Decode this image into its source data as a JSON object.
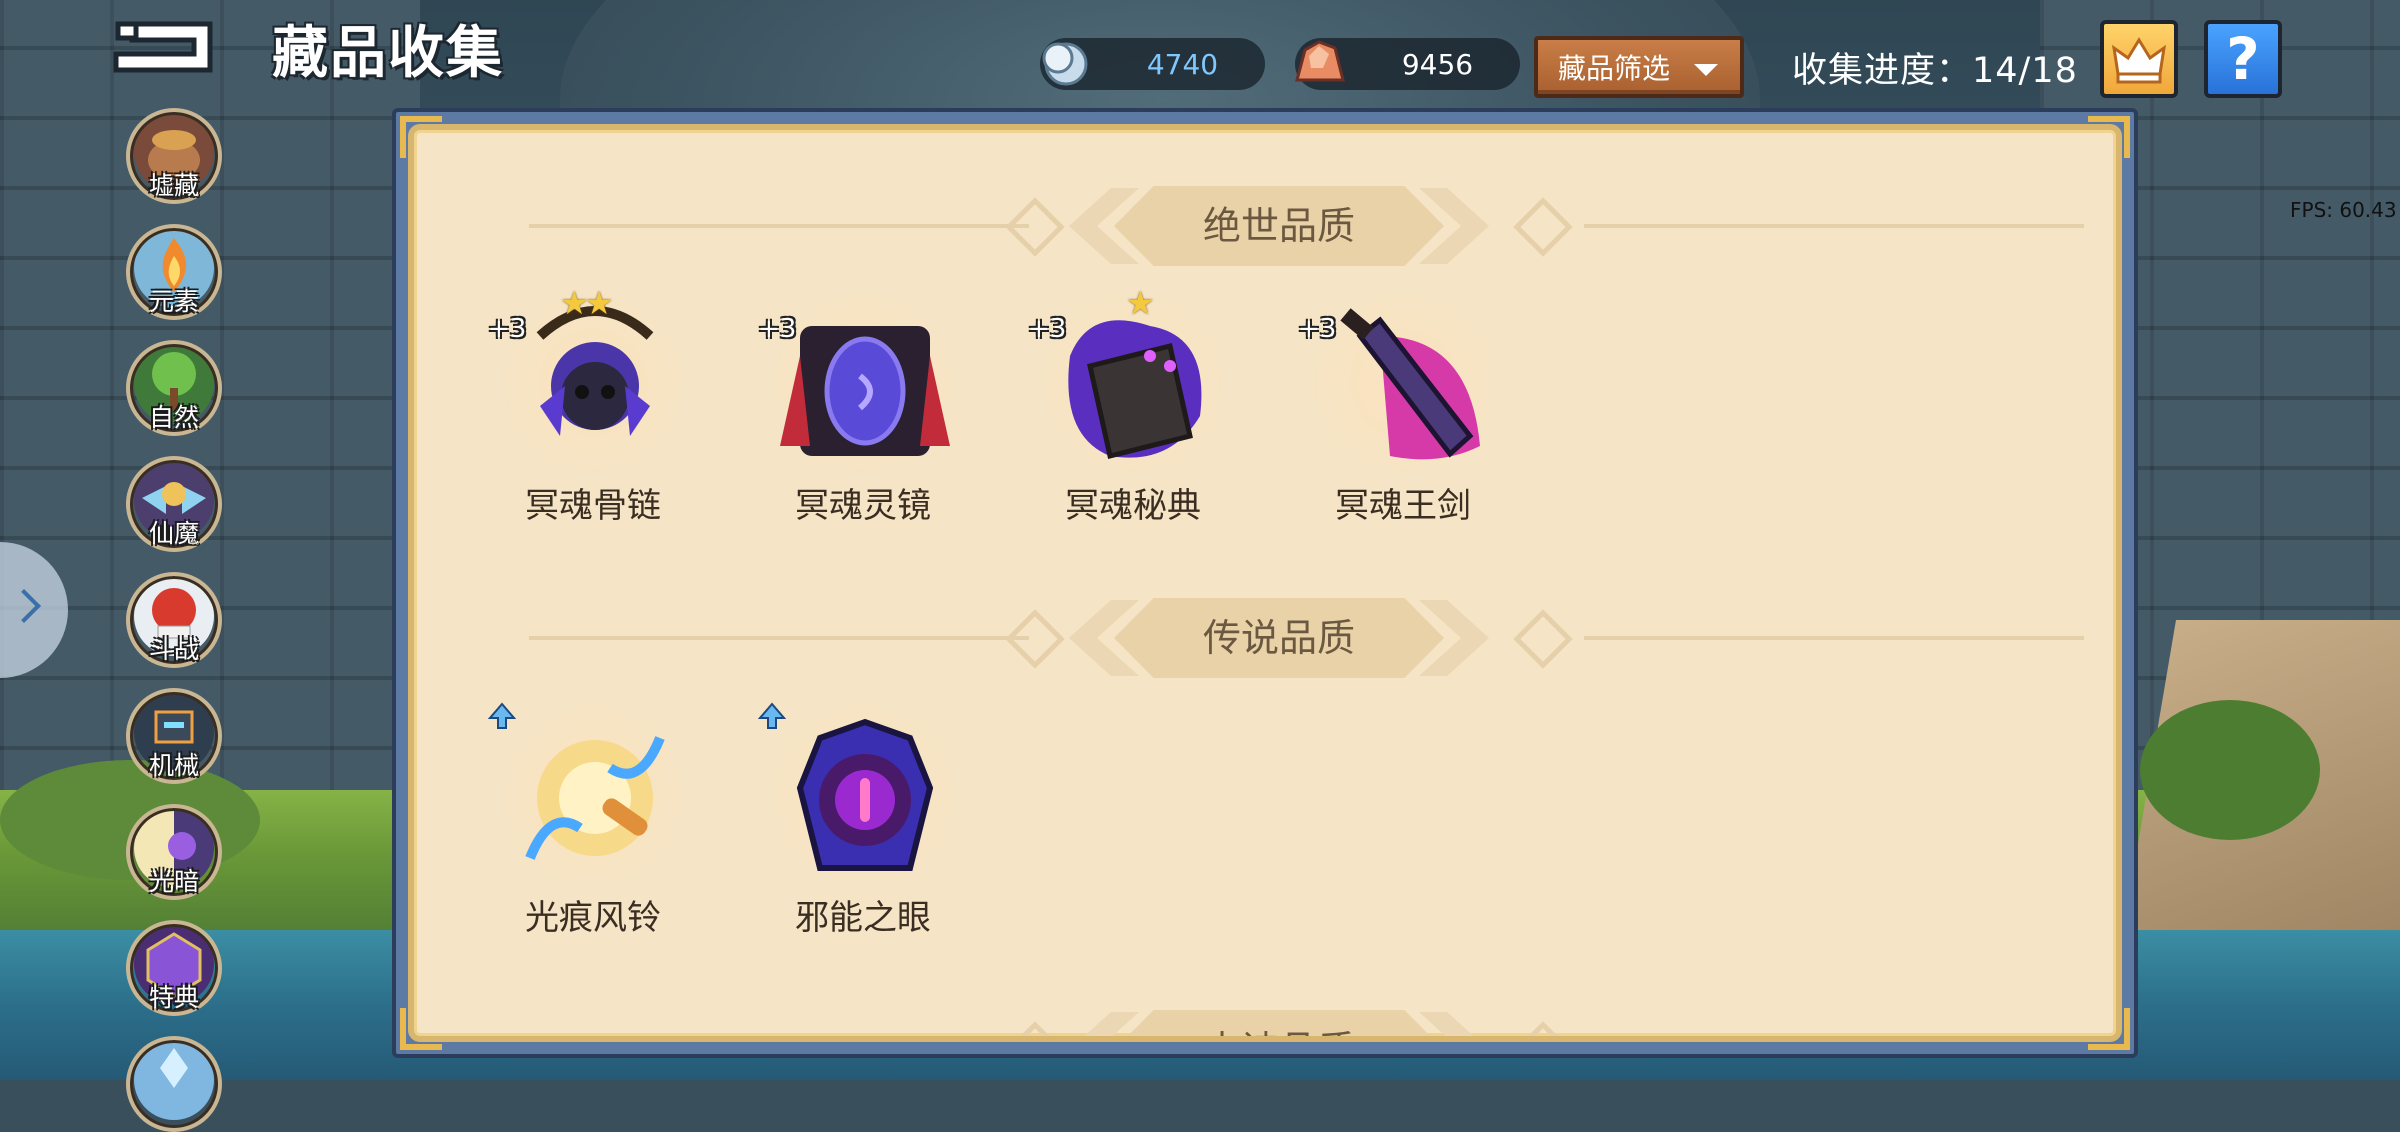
{
  "header": {
    "title": "藏品收集",
    "silver": "4740",
    "ore": "9456",
    "filter_label": "藏品筛选",
    "progress": "收集进度：14/18",
    "help_label": "?",
    "fps": "FPS: 60.43"
  },
  "sidebar": {
    "items": [
      {
        "label": "墟藏"
      },
      {
        "label": "元素"
      },
      {
        "label": "自然"
      },
      {
        "label": "仙魔"
      },
      {
        "label": "斗战"
      },
      {
        "label": "机械"
      },
      {
        "label": "光暗",
        "active": true
      },
      {
        "label": "特典"
      }
    ]
  },
  "sections": [
    {
      "title": "绝世品质",
      "items": [
        {
          "name": "冥魂骨链",
          "plus": "+3",
          "stars": "★★"
        },
        {
          "name": "冥魂灵镜",
          "plus": "+3",
          "stars": ""
        },
        {
          "name": "冥魂秘典",
          "plus": "+3",
          "stars": "★"
        },
        {
          "name": "冥魂王剑",
          "plus": "+3",
          "stars": ""
        }
      ]
    },
    {
      "title": "传说品质",
      "items": [
        {
          "name": "光痕风铃",
          "upgrade": true
        },
        {
          "name": "邪能之眼",
          "upgrade": true
        }
      ]
    },
    {
      "title": "史诗品质",
      "items": []
    }
  ],
  "colors": {
    "panel_bg": "#f5e4c5",
    "accent_gold": "#e8b94f",
    "silver_text": "#7fc8ff",
    "filter_button": "#c97e48",
    "help_button": "#2872d8"
  },
  "icons": {
    "back": "back-arrow-icon",
    "silver": "silver-coin-icon",
    "ore": "ore-gem-icon",
    "crown": "crown-icon",
    "help": "question-icon"
  }
}
